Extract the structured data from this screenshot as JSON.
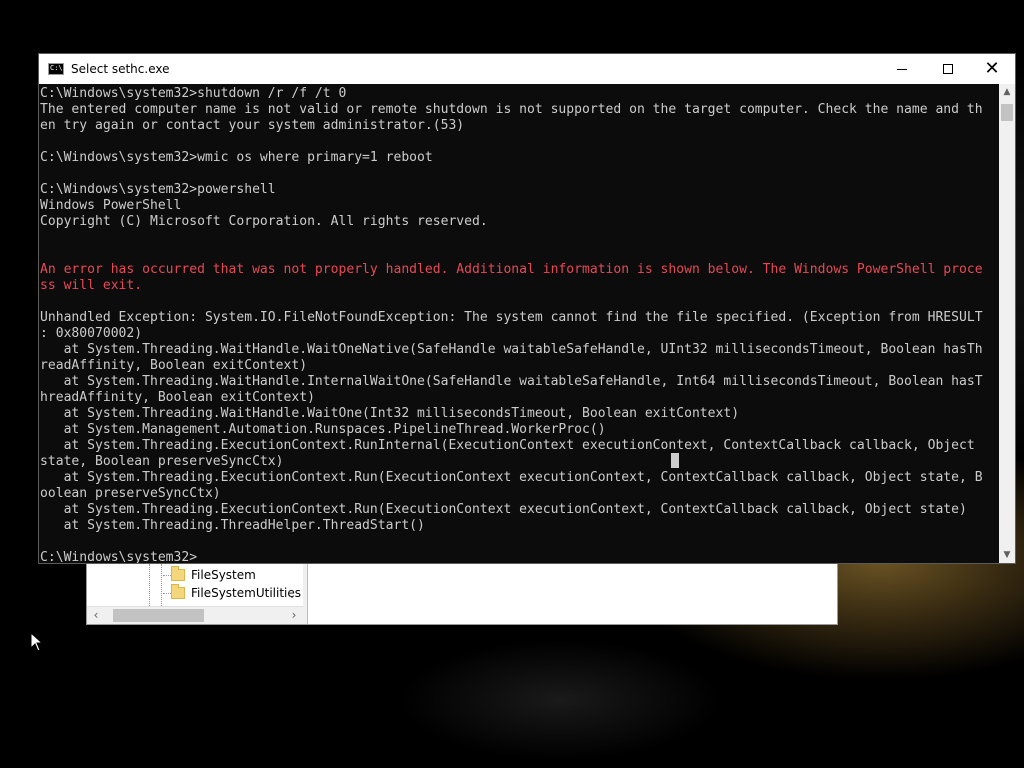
{
  "console": {
    "title": "Select sethc.exe",
    "lines": [
      {
        "text": "C:\\Windows\\system32>shutdown /r /f /t 0",
        "error": false
      },
      {
        "text": "The entered computer name is not valid or remote shutdown is not supported on the target computer. Check the name and th",
        "error": false
      },
      {
        "text": "en try again or contact your system administrator.(53)",
        "error": false
      },
      {
        "text": "",
        "error": false
      },
      {
        "text": "C:\\Windows\\system32>wmic os where primary=1 reboot",
        "error": false
      },
      {
        "text": "",
        "error": false
      },
      {
        "text": "C:\\Windows\\system32>powershell",
        "error": false
      },
      {
        "text": "Windows PowerShell",
        "error": false
      },
      {
        "text": "Copyright (C) Microsoft Corporation. All rights reserved.",
        "error": false
      },
      {
        "text": "",
        "error": false
      },
      {
        "text": "",
        "error": false
      },
      {
        "text": "An error has occurred that was not properly handled. Additional information is shown below. The Windows PowerShell proce",
        "error": true
      },
      {
        "text": "ss will exit.",
        "error": true
      },
      {
        "text": "",
        "error": false
      },
      {
        "text": "Unhandled Exception: System.IO.FileNotFoundException: The system cannot find the file specified. (Exception from HRESULT",
        "error": false
      },
      {
        "text": ": 0x80070002)",
        "error": false
      },
      {
        "text": "   at System.Threading.WaitHandle.WaitOneNative(SafeHandle waitableSafeHandle, UInt32 millisecondsTimeout, Boolean hasTh",
        "error": false
      },
      {
        "text": "readAffinity, Boolean exitContext)",
        "error": false
      },
      {
        "text": "   at System.Threading.WaitHandle.InternalWaitOne(SafeHandle waitableSafeHandle, Int64 millisecondsTimeout, Boolean hasT",
        "error": false
      },
      {
        "text": "hreadAffinity, Boolean exitContext)",
        "error": false
      },
      {
        "text": "   at System.Threading.WaitHandle.WaitOne(Int32 millisecondsTimeout, Boolean exitContext)",
        "error": false
      },
      {
        "text": "   at System.Management.Automation.Runspaces.PipelineThread.WorkerProc()",
        "error": false
      },
      {
        "text": "   at System.Threading.ExecutionContext.RunInternal(ExecutionContext executionContext, ContextCallback callback, Object",
        "error": false
      },
      {
        "text": "state, Boolean preserveSyncCtx)",
        "error": false
      },
      {
        "text": "   at System.Threading.ExecutionContext.Run(ExecutionContext executionContext, ContextCallback callback, Object state, B",
        "error": false
      },
      {
        "text": "oolean preserveSyncCtx)",
        "error": false
      },
      {
        "text": "   at System.Threading.ExecutionContext.Run(ExecutionContext executionContext, ContextCallback callback, Object state)",
        "error": false
      },
      {
        "text": "   at System.Threading.ThreadHelper.ThreadStart()",
        "error": false
      },
      {
        "text": "",
        "error": false
      },
      {
        "text": "C:\\Windows\\system32>",
        "error": false
      }
    ]
  },
  "background_window": {
    "tree_items": [
      {
        "label": "FileSystem"
      },
      {
        "label": "FileSystemUtilities"
      }
    ]
  },
  "colors": {
    "console_bg": "#0c0c0c",
    "console_text": "#cccccc",
    "error_text": "#e74856",
    "titlebar_bg": "#ffffff"
  },
  "icons": {
    "console_app": "cmd-icon",
    "folder": "folder-icon",
    "pointer": "mouse-pointer-icon"
  }
}
